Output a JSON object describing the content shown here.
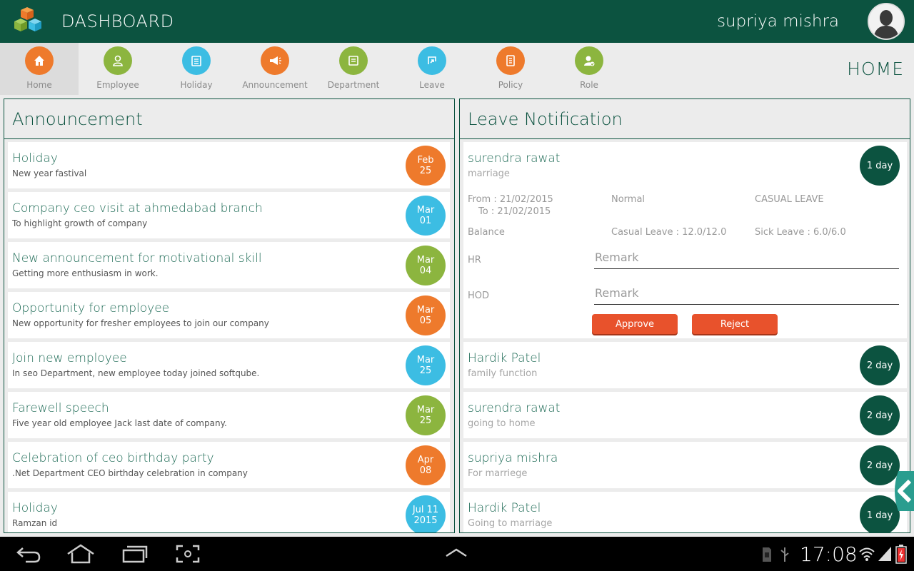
{
  "app": {
    "title": "DASHBOARD",
    "user_name": "supriya mishra",
    "page_label": "HOME"
  },
  "nav": [
    {
      "label": "Home",
      "icon": "home-icon",
      "color": "#ee7a2c"
    },
    {
      "label": "Employee",
      "icon": "employee-icon",
      "color": "#8cb53f"
    },
    {
      "label": "Holiday",
      "icon": "holiday-icon",
      "color": "#3cbde3"
    },
    {
      "label": "Announcement",
      "icon": "announcement-icon",
      "color": "#ee7a2c"
    },
    {
      "label": "Department",
      "icon": "department-icon",
      "color": "#8cb53f"
    },
    {
      "label": "Leave",
      "icon": "leave-icon",
      "color": "#3cbde3"
    },
    {
      "label": "Policy",
      "icon": "policy-icon",
      "color": "#ee7a2c"
    },
    {
      "label": "Role",
      "icon": "role-icon",
      "color": "#8cb53f"
    }
  ],
  "announcement": {
    "heading": "Announcement",
    "items": [
      {
        "title": "Holiday",
        "subtitle": "New year fastival",
        "date_line1": "Feb",
        "date_line2": "25",
        "color": "#ee7a2c"
      },
      {
        "title": "Company ceo visit at ahmedabad branch",
        "subtitle": "To highlight growth of company",
        "date_line1": "Mar",
        "date_line2": "01",
        "color": "#3cbde3"
      },
      {
        "title": "New announcement for motivational skill",
        "subtitle": "Getting more enthusiasm in work.",
        "date_line1": "Mar",
        "date_line2": "04",
        "color": "#8cb53f"
      },
      {
        "title": "Opportunity for employee",
        "subtitle": "New opportunity for fresher employees to join our company",
        "date_line1": "Mar",
        "date_line2": "05",
        "color": "#ee7a2c"
      },
      {
        "title": "Join new employee",
        "subtitle": "In seo Department, new employee today joined softqube.",
        "date_line1": "Mar",
        "date_line2": "25",
        "color": "#3cbde3"
      },
      {
        "title": "Farewell speech",
        "subtitle": "Five year old employee Jack last date of company.",
        "date_line1": "Mar",
        "date_line2": "25",
        "color": "#8cb53f"
      },
      {
        "title": "Celebration of ceo birthday party",
        "subtitle": ".Net Department CEO birthday celebration in company",
        "date_line1": "Apr",
        "date_line2": "08",
        "color": "#ee7a2c"
      },
      {
        "title": "Holiday",
        "subtitle": "Ramzan id",
        "date_line1": "Jul 11",
        "date_line2": "2015",
        "color": "#3cbde3"
      }
    ]
  },
  "leave": {
    "heading": "Leave Notification",
    "expanded": {
      "name": "surendra rawat",
      "reason": "marriage",
      "days": "1 day",
      "from": "From : 21/02/2015",
      "to": "To : 21/02/2015",
      "type": "Normal",
      "category": "CASUAL LEAVE",
      "balance_label": "Balance",
      "casual_balance": "Casual Leave : 12.0/12.0",
      "sick_balance": "Sick Leave : 6.0/6.0",
      "hr_label": "HR",
      "hod_label": "HOD",
      "remark_placeholder": "Remark",
      "approve_label": "Approve",
      "reject_label": "Reject"
    },
    "items": [
      {
        "name": "Hardik Patel",
        "reason": "family function",
        "days": "2 day"
      },
      {
        "name": "surendra rawat",
        "reason": "going to home",
        "days": "2 day"
      },
      {
        "name": "supriya mishra",
        "reason": "For marriege",
        "days": "2 day"
      },
      {
        "name": "Hardik Patel",
        "reason": "Going to marriage",
        "days": "1 day"
      }
    ]
  },
  "system_bar": {
    "time": "17:08"
  }
}
